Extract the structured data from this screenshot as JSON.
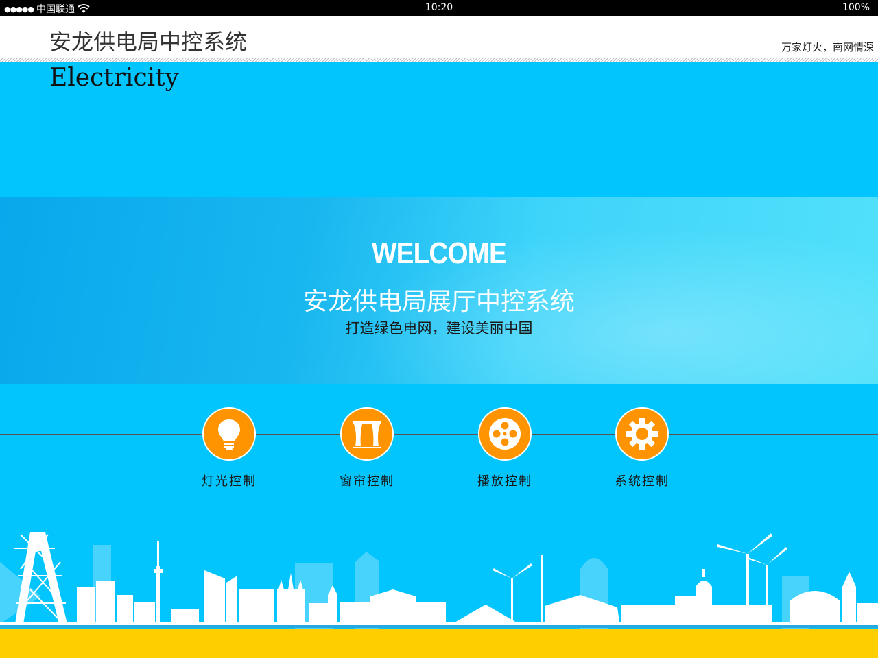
{
  "status_bar": {
    "carrier": "中国联通",
    "signal": "●●●●●",
    "time": "10:20",
    "battery": "100%"
  },
  "header": {
    "title": "安龙供电局中控系统",
    "slogan": "万家灯火，南网情深"
  },
  "subtitle": "Electricity",
  "banner": {
    "welcome": "WELCOME",
    "title": "安龙供电局展厅中控系统",
    "subtitle": "打造绿色电网，建设美丽中国"
  },
  "controls": [
    {
      "label": "灯光控制",
      "icon": "bulb-icon"
    },
    {
      "label": "窗帘控制",
      "icon": "curtain-icon"
    },
    {
      "label": "播放控制",
      "icon": "film-reel-icon"
    },
    {
      "label": "系统控制",
      "icon": "gear-icon"
    }
  ],
  "colors": {
    "background": "#03c5fd",
    "accent": "#ff9400",
    "footer": "#ffce00"
  }
}
